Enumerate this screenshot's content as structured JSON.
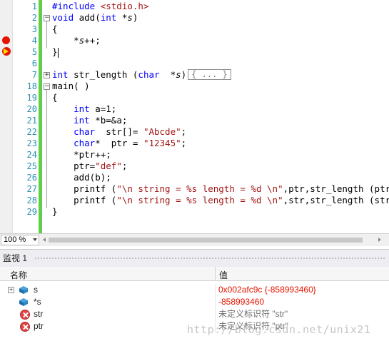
{
  "editor": {
    "lines": [
      {
        "num": "1",
        "html_key": "l1"
      },
      {
        "num": "2",
        "html_key": "l2"
      },
      {
        "num": "3",
        "html_key": "l3"
      },
      {
        "num": "4",
        "html_key": "l4"
      },
      {
        "num": "5",
        "html_key": "l5"
      },
      {
        "num": "6",
        "html_key": "l6"
      },
      {
        "num": "7",
        "html_key": "l7"
      },
      {
        "num": "18",
        "html_key": "l18"
      },
      {
        "num": "19",
        "html_key": "l19"
      },
      {
        "num": "20",
        "html_key": "l20"
      },
      {
        "num": "21",
        "html_key": "l21"
      },
      {
        "num": "22",
        "html_key": "l22"
      },
      {
        "num": "23",
        "html_key": "l23"
      },
      {
        "num": "24",
        "html_key": "l24"
      },
      {
        "num": "25",
        "html_key": "l25"
      },
      {
        "num": "26",
        "html_key": "l26"
      },
      {
        "num": "27",
        "html_key": "l27"
      },
      {
        "num": "28",
        "html_key": "l28"
      },
      {
        "num": "29",
        "html_key": "l29"
      }
    ],
    "code": {
      "l1": [
        {
          "t": "#include ",
          "c": "kw"
        },
        {
          "t": "<stdio.h>",
          "c": "str"
        }
      ],
      "l2": [
        {
          "t": "void",
          "c": "kw"
        },
        {
          "t": " add(",
          "c": "def"
        },
        {
          "t": "int",
          "c": "kw"
        },
        {
          "t": " *",
          "c": "def"
        },
        {
          "t": "s",
          "c": "ital"
        },
        {
          "t": ")",
          "c": "def"
        }
      ],
      "l3": [
        {
          "t": "{",
          "c": "def"
        }
      ],
      "l4": [
        {
          "t": "    *",
          "c": "def"
        },
        {
          "t": "s",
          "c": "ital"
        },
        {
          "t": "++;",
          "c": "def"
        }
      ],
      "l5": [
        {
          "t": "}",
          "c": "def"
        }
      ],
      "l6": [],
      "l7": [
        {
          "t": "int",
          "c": "kw"
        },
        {
          "t": " str_length (",
          "c": "def"
        },
        {
          "t": "char",
          "c": "kw"
        },
        {
          "t": "  *",
          "c": "def"
        },
        {
          "t": "s",
          "c": "ital"
        },
        {
          "t": ")",
          "c": "def"
        }
      ],
      "l18": [
        {
          "t": "main( )",
          "c": "def"
        }
      ],
      "l19": [
        {
          "t": "{",
          "c": "def"
        }
      ],
      "l20": [
        {
          "t": "    ",
          "c": "def"
        },
        {
          "t": "int",
          "c": "kw"
        },
        {
          "t": " a=1;",
          "c": "def"
        }
      ],
      "l21": [
        {
          "t": "    ",
          "c": "def"
        },
        {
          "t": "int",
          "c": "kw"
        },
        {
          "t": " *b=&a;",
          "c": "def"
        }
      ],
      "l22": [
        {
          "t": "    ",
          "c": "def"
        },
        {
          "t": "char",
          "c": "kw"
        },
        {
          "t": "  str[]= ",
          "c": "def"
        },
        {
          "t": "\"Abcde\"",
          "c": "str"
        },
        {
          "t": ";",
          "c": "def"
        }
      ],
      "l23": [
        {
          "t": "    ",
          "c": "def"
        },
        {
          "t": "char",
          "c": "kw"
        },
        {
          "t": "*  ptr = ",
          "c": "def"
        },
        {
          "t": "\"12345\"",
          "c": "str"
        },
        {
          "t": ";",
          "c": "def"
        }
      ],
      "l24": [
        {
          "t": "    *ptr++;",
          "c": "def"
        }
      ],
      "l25": [
        {
          "t": "    ptr=",
          "c": "def"
        },
        {
          "t": "\"def\"",
          "c": "str"
        },
        {
          "t": ";",
          "c": "def"
        }
      ],
      "l26": [
        {
          "t": "    add(b);",
          "c": "def"
        }
      ],
      "l27": [
        {
          "t": "    printf (",
          "c": "def"
        },
        {
          "t": "\"\\n string = %s length = %d \\n\"",
          "c": "str"
        },
        {
          "t": ",ptr,str_length (ptr));",
          "c": "def"
        }
      ],
      "l28": [
        {
          "t": "    printf (",
          "c": "def"
        },
        {
          "t": "\"\\n string = %s length = %d \\n\"",
          "c": "str"
        },
        {
          "t": ",str,str_length (str));",
          "c": "def"
        }
      ],
      "l29": [
        {
          "t": "}",
          "c": "def"
        }
      ]
    },
    "collapsed_label": "{ ... }",
    "fold_minus": "−",
    "fold_plus": "+"
  },
  "zoom": {
    "value": "100 %"
  },
  "watch": {
    "title": "监视 1",
    "col_name": "名称",
    "col_value": "值",
    "rows": [
      {
        "name": "s",
        "value": "0x002afc9c {-858993460}",
        "icon": "variable-icon",
        "expandable": true,
        "value_color": "#e51400"
      },
      {
        "name": "*s",
        "value": "-858993460",
        "icon": "variable-icon",
        "expandable": false,
        "value_color": "#e51400"
      },
      {
        "name": "str",
        "value": "未定义标识符 \"str\"",
        "icon": "error-icon",
        "expandable": false,
        "value_color": "#6e6e6e"
      },
      {
        "name": "ptr",
        "value": "未定义标识符 \"ptr\"",
        "icon": "error-icon",
        "expandable": false,
        "value_color": "#6e6e6e"
      }
    ]
  },
  "watermark": "http://blog.csdn.net/unix21",
  "colors": {
    "keyword": "#0000ff",
    "string": "#a31515",
    "line_number": "#2b91af",
    "breakpoint": "#e51400",
    "change_bar": "#5fcf4a"
  }
}
